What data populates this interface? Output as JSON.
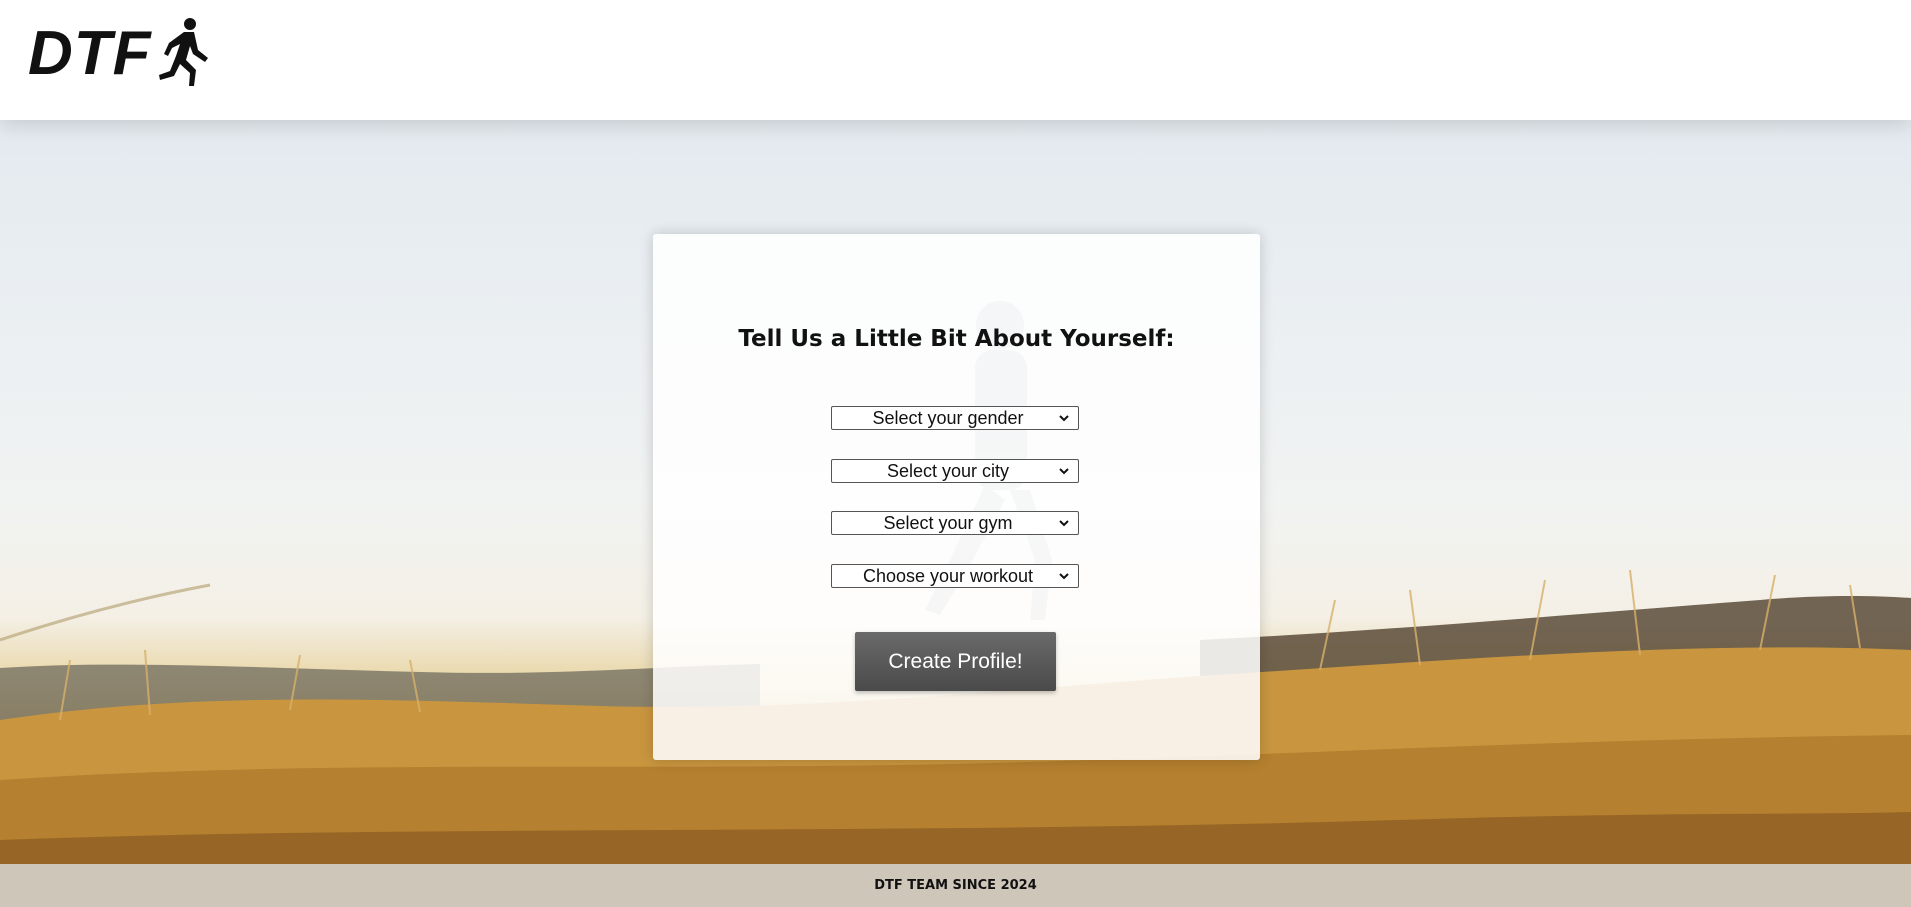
{
  "header": {
    "logo_text": "DTF",
    "logo_icon": "runner-icon"
  },
  "form": {
    "title": "Tell Us a Little Bit About Yourself:",
    "selects": [
      {
        "label": "Select your gender"
      },
      {
        "label": "Select your city"
      },
      {
        "label": "Select your gym"
      },
      {
        "label": "Choose your workout"
      }
    ],
    "submit_label": "Create Profile!"
  },
  "footer": {
    "text": "DTF TEAM SINCE 2024"
  },
  "colors": {
    "header_bg": "#ffffff",
    "button_bg": "#5a5a5a",
    "button_text": "#ffffff",
    "footer_bg": "#dcdcdc"
  }
}
